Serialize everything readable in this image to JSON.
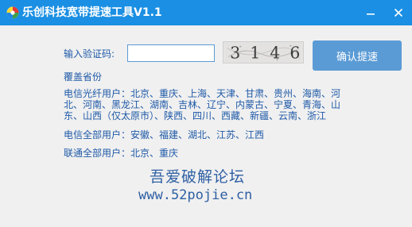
{
  "window": {
    "title": "乐创科技宽带提速工具V1.1",
    "app_icon": "rainbow-circle-icon",
    "minimize_icon": "minimize-icon",
    "close_icon": "close-icon",
    "titlebar_color": "#1a8fe3"
  },
  "verify": {
    "label": "输入验证码:",
    "input_value": "",
    "captcha_text": "3 1 4 6",
    "confirm_label": "确认提速"
  },
  "coverage": {
    "heading": "覆盖省份",
    "telecom_fiber_lines": [
      "电信光纤用户：北京、重庆、上海、天津、甘肃、贵州、海南、河",
      "北、河南、黑龙江、湖南、吉林、辽宁、内蒙古、宁夏、青海、山",
      "东、山西（仅太原市）、陕西、四川、西藏、新疆、云南、浙江"
    ],
    "telecom_all": "电信全部用户：安徽、福建、湖北、江苏、江西",
    "unicom_all": "联通全部用户：北京、重庆"
  },
  "watermark": {
    "name": "吾爱破解论坛",
    "url": "www.52pojie.cn"
  },
  "colors": {
    "text": "#1f5aa8",
    "button": "#5b9bd5",
    "background": "#f0f0f0"
  }
}
